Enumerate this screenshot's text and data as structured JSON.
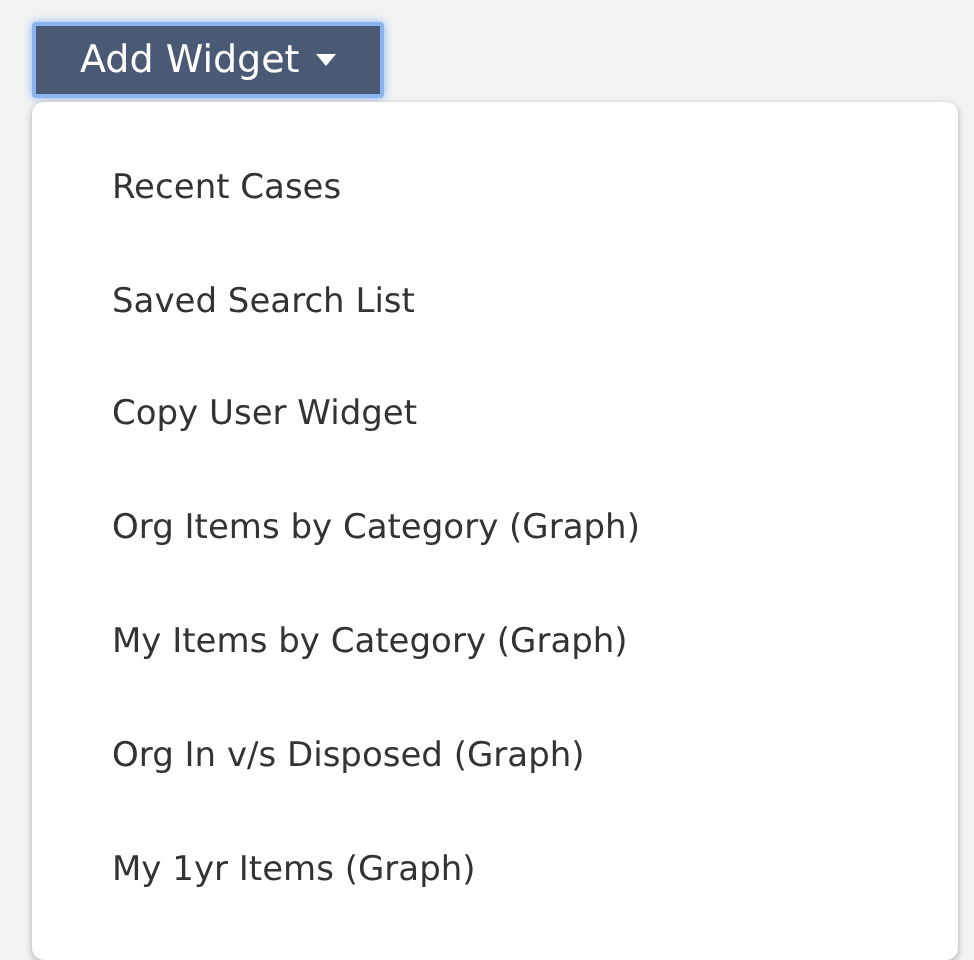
{
  "add_widget_button": {
    "label": "Add Widget",
    "expanded": true
  },
  "menu_items": [
    {
      "label": "Recent Cases"
    },
    {
      "label": "Saved Search List"
    },
    {
      "label": "Copy User Widget"
    },
    {
      "label": "Org Items by Category (Graph)"
    },
    {
      "label": "My Items by Category (Graph)"
    },
    {
      "label": "Org In v/s Disposed (Graph)"
    },
    {
      "label": "My 1yr Items (Graph)"
    }
  ]
}
